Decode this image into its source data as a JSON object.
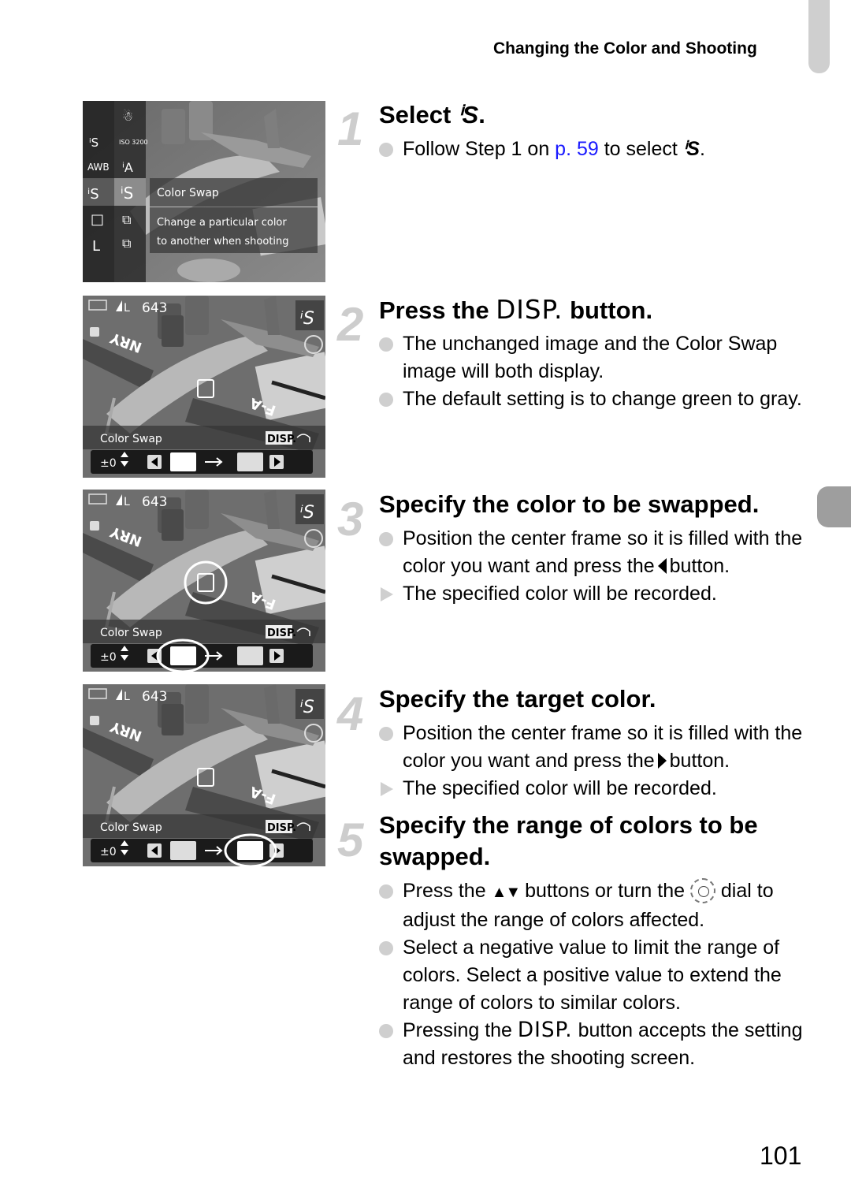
{
  "header": {
    "section_title": "Changing the Color and Shooting"
  },
  "page_number": "101",
  "icons": {
    "color_swap": "ⁱS",
    "disp": "DISP."
  },
  "steps": [
    {
      "number": "1",
      "title_prefix": "Select",
      "title_suffix": ".",
      "bullets": [
        {
          "type": "dot",
          "pre": "Follow Step 1 on ",
          "link": "p. 59",
          "post": " to select",
          "end": "."
        }
      ]
    },
    {
      "number": "2",
      "title_prefix": "Press the",
      "title_suffix": "button.",
      "bullets": [
        {
          "type": "dot",
          "text": "The unchanged image and the Color Swap image will both display."
        },
        {
          "type": "dot",
          "text": "The default setting is to change green to gray."
        }
      ]
    },
    {
      "number": "3",
      "title": "Specify the color to be swapped.",
      "bullets": [
        {
          "type": "dot",
          "pre": "Position the center frame so it is filled with the color you want and press the",
          "post": "button."
        },
        {
          "type": "triangle",
          "text": "The specified color will be recorded."
        }
      ]
    },
    {
      "number": "4",
      "title": "Specify the target color.",
      "bullets": [
        {
          "type": "dot",
          "pre": "Position the center frame so it is filled with the color you want and press the",
          "post": "button."
        },
        {
          "type": "triangle",
          "text": "The specified color will be recorded."
        }
      ]
    },
    {
      "number": "5",
      "title": "Specify the range of colors to be swapped.",
      "bullets": [
        {
          "type": "dot",
          "pre": "Press the ",
          "arrows": "▲▼",
          "mid": " buttons or turn the ",
          "post": " dial to adjust the range of colors affected."
        },
        {
          "type": "dot",
          "text": "Select a negative value to limit the range of colors. Select a positive value to extend the range of colors to similar colors."
        },
        {
          "type": "dot",
          "pre": "Pressing the ",
          "post": " button accepts the setting and restores the shooting screen."
        }
      ]
    }
  ],
  "screens": {
    "menu": {
      "left_col": [
        "ⁱS",
        "AWB",
        "ⁱS",
        "□",
        "L"
      ],
      "right_col": [
        "☃",
        "ISO 3200",
        "ⁱA",
        "ⁱS",
        "⧉",
        "⧉"
      ],
      "selected_label": "Color Swap",
      "description_line1": "Change a particular color",
      "description_line2": "to another when shooting"
    },
    "lcd": {
      "shots_remaining": "643",
      "image_size": "L",
      "mode_label": "Color Swap",
      "range_value": "±0",
      "disp_label": "DISP.",
      "wing_text_1": "NRY",
      "wing_text_2": "F-A"
    }
  }
}
